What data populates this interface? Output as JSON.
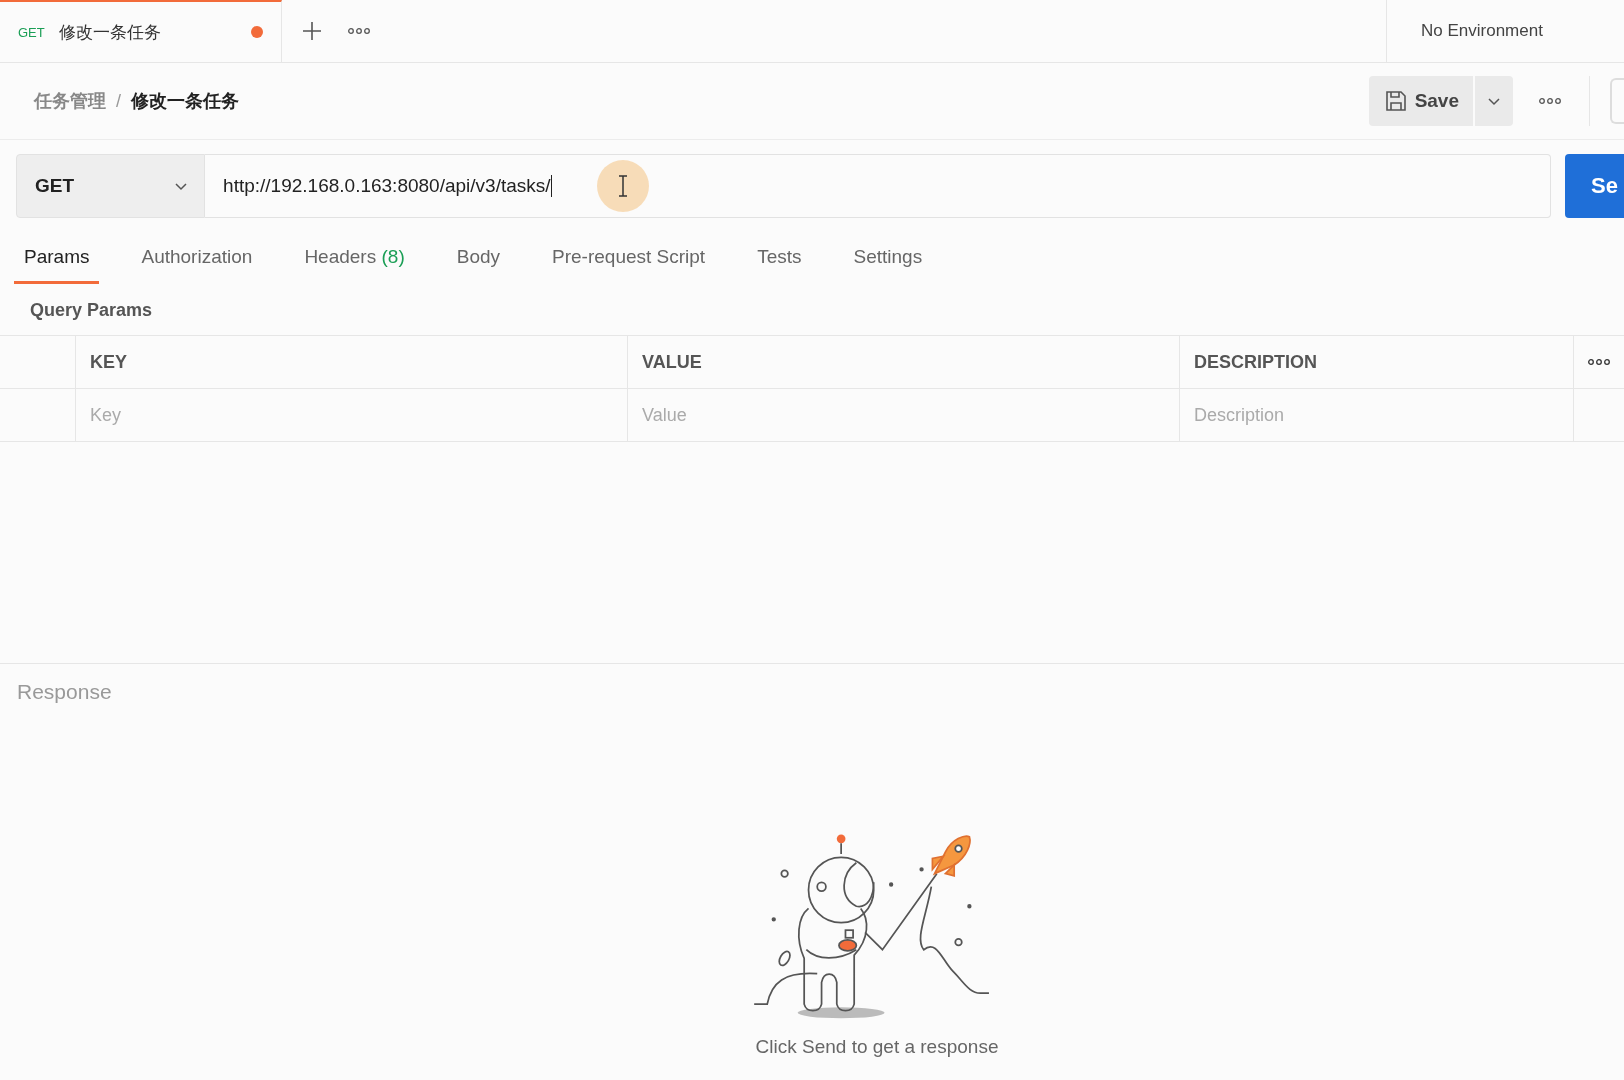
{
  "tab_bar": {
    "tabs": [
      {
        "method": "GET",
        "title": "修改一条任务",
        "unsaved": true,
        "selected": true
      }
    ],
    "environment": "No Environment"
  },
  "breadcrumb_separator": "/",
  "breadcrumb": [
    {
      "label": "任务管理",
      "current": false
    },
    {
      "label": "修改一条任务",
      "current": true
    }
  ],
  "save_button": {
    "label": "Save"
  },
  "request": {
    "method": "GET",
    "url": "http://192.168.0.163:8080/api/v3/tasks/",
    "send_label": "Se"
  },
  "request_tabs": [
    {
      "label": "Params",
      "selected": true
    },
    {
      "label": "Authorization",
      "selected": false
    },
    {
      "label": "Headers",
      "count": "(8)",
      "selected": false
    },
    {
      "label": "Body",
      "selected": false
    },
    {
      "label": "Pre-request Script",
      "selected": false
    },
    {
      "label": "Tests",
      "selected": false
    },
    {
      "label": "Settings",
      "selected": false
    }
  ],
  "query_params": {
    "title": "Query Params",
    "columns": [
      "KEY",
      "VALUE",
      "DESCRIPTION"
    ],
    "placeholders": [
      "Key",
      "Value",
      "Description"
    ]
  },
  "response": {
    "title": "Response",
    "empty_message": "Click Send to get a response"
  }
}
